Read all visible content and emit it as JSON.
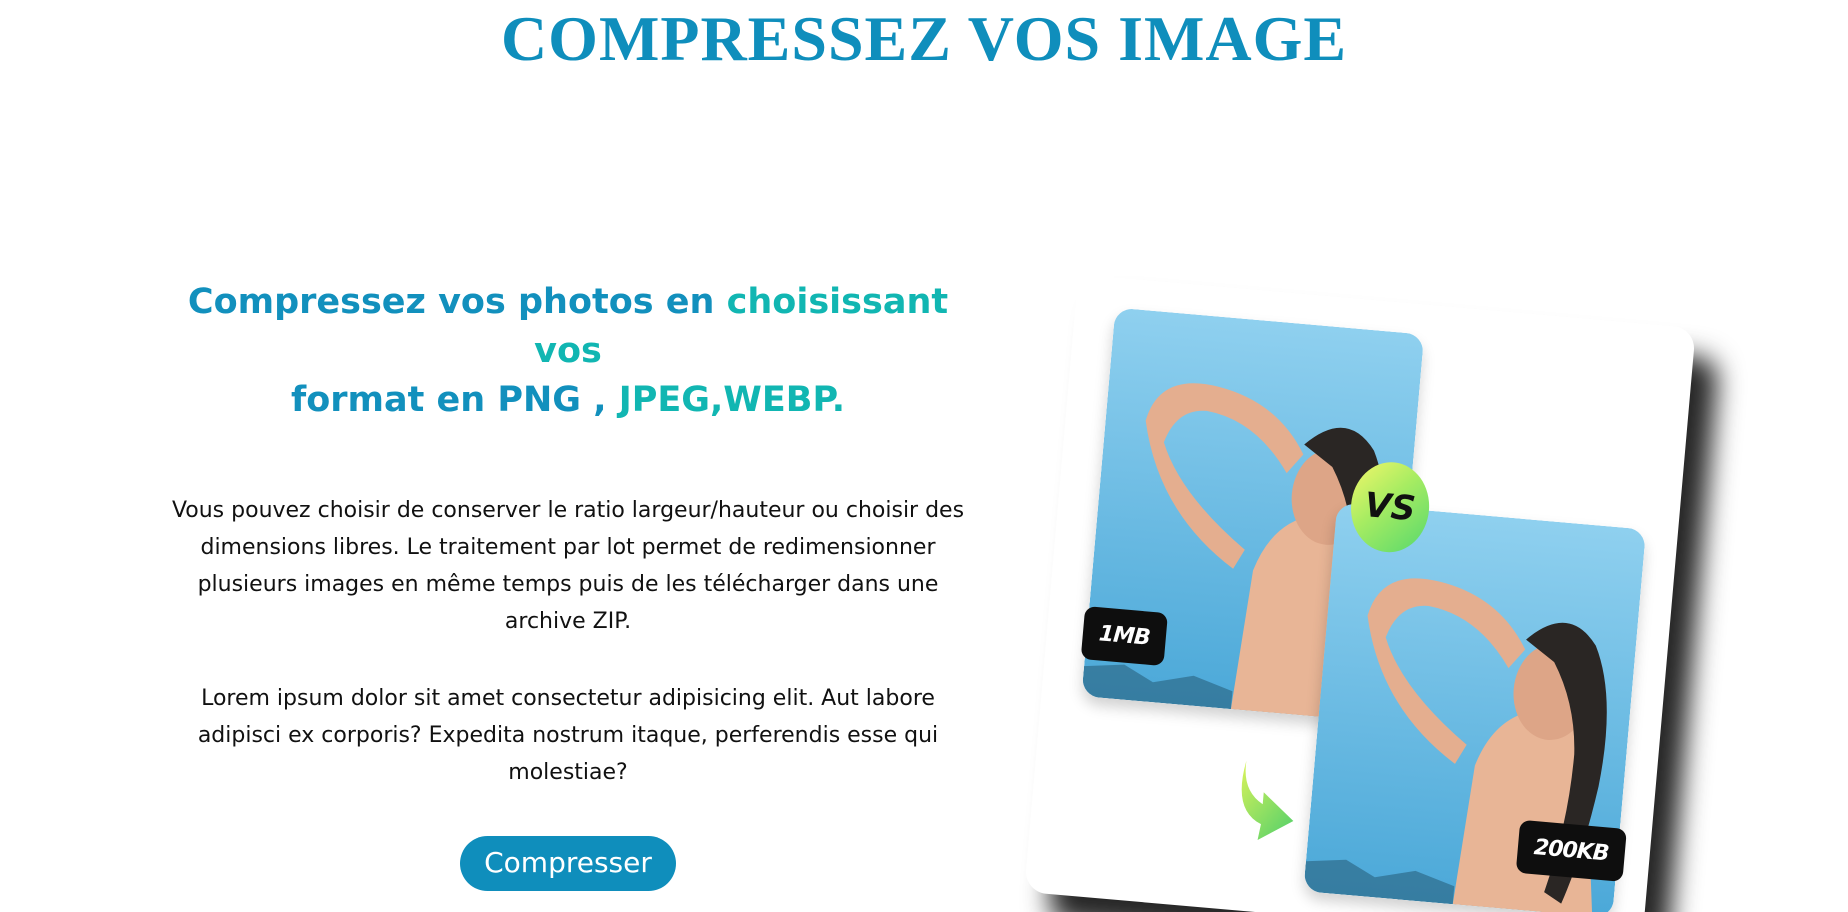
{
  "header": {
    "title": "COMPRESSEZ VOS IMAGE"
  },
  "main": {
    "heading_part1": "Compressez vos photos en ",
    "heading_part2": "choisissant vos",
    "heading_part3": "format en PNG , ",
    "heading_part4": "JPEG,WEBP.",
    "paragraph1": "Vous pouvez choisir de conserver le ratio largeur/hauteur ou choisir des dimensions libres. Le traitement par lot permet de redimensionner plusieurs images en même temps puis de les télécharger dans une archive ZIP.",
    "paragraph2": "Lorem ipsum dolor sit amet consectetur adipisicing elit. Aut labore adipisci ex corporis? Expedita nostrum itaque, perferendis esse qui molestiae?",
    "button_label": "Compresser"
  },
  "illustration": {
    "before_size": "1MB",
    "after_size": "200KB",
    "vs_label": "VS"
  },
  "colors": {
    "primary": "#0f8ebc",
    "accent": "#11b6b2"
  }
}
